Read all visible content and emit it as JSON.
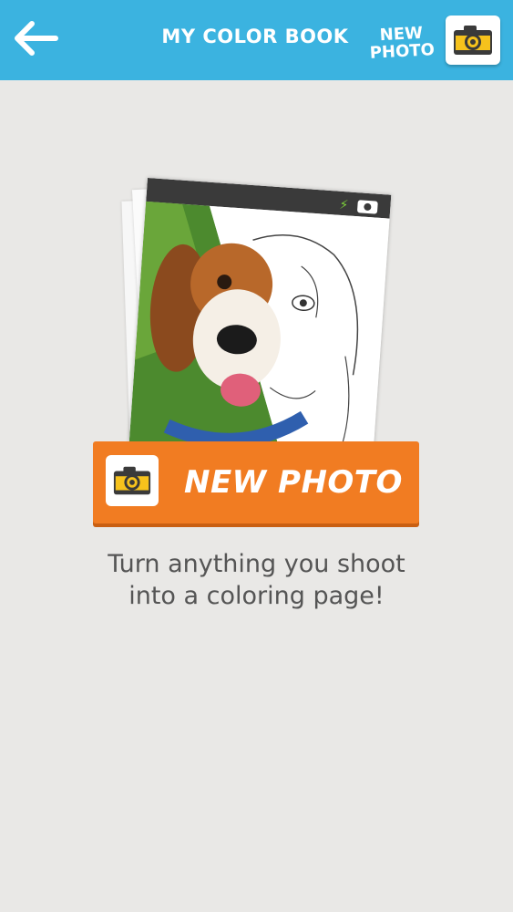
{
  "header": {
    "title": "MY COLOR BOOK",
    "new_photo_line1": "NEW",
    "new_photo_line2": "PHOTO",
    "back_icon": "arrow-left-icon",
    "camera_icon": "camera-icon"
  },
  "main": {
    "button_label": "NEW PHOTO",
    "tagline_line1": "Turn anything you shoot",
    "tagline_line2": "into a coloring page!"
  },
  "colors": {
    "header_bg": "#3bb3e0",
    "button_bg": "#f17c22",
    "camera_yellow": "#f6c21c",
    "background": "#e9e8e6"
  }
}
